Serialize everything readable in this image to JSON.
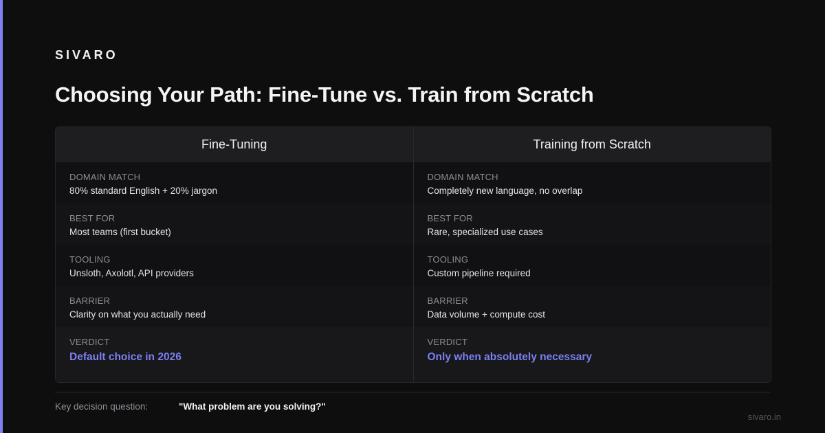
{
  "brand": "SIVARO",
  "title": "Choosing Your Path: Fine-Tune vs. Train from Scratch",
  "colors": {
    "accent": "#7b7ff0",
    "background": "#0e0e0f"
  },
  "table": {
    "columns": [
      {
        "header": "Fine-Tuning",
        "rows": [
          {
            "label": "DOMAIN MATCH",
            "value": "80% standard English + 20% jargon"
          },
          {
            "label": "BEST FOR",
            "value": "Most teams (first bucket)"
          },
          {
            "label": "TOOLING",
            "value": "Unsloth, Axolotl, API providers"
          },
          {
            "label": "BARRIER",
            "value": "Clarity on what you actually need"
          }
        ],
        "verdict": {
          "label": "VERDICT",
          "value": "Default choice in 2026"
        }
      },
      {
        "header": "Training from Scratch",
        "rows": [
          {
            "label": "DOMAIN MATCH",
            "value": "Completely new language, no overlap"
          },
          {
            "label": "BEST FOR",
            "value": "Rare, specialized use cases"
          },
          {
            "label": "TOOLING",
            "value": "Custom pipeline required"
          },
          {
            "label": "BARRIER",
            "value": "Data volume + compute cost"
          }
        ],
        "verdict": {
          "label": "VERDICT",
          "value": "Only when absolutely necessary"
        }
      }
    ]
  },
  "footer": {
    "label": "Key decision question:",
    "question": "\"What problem are you solving?\"",
    "site": "sivaro.in"
  }
}
